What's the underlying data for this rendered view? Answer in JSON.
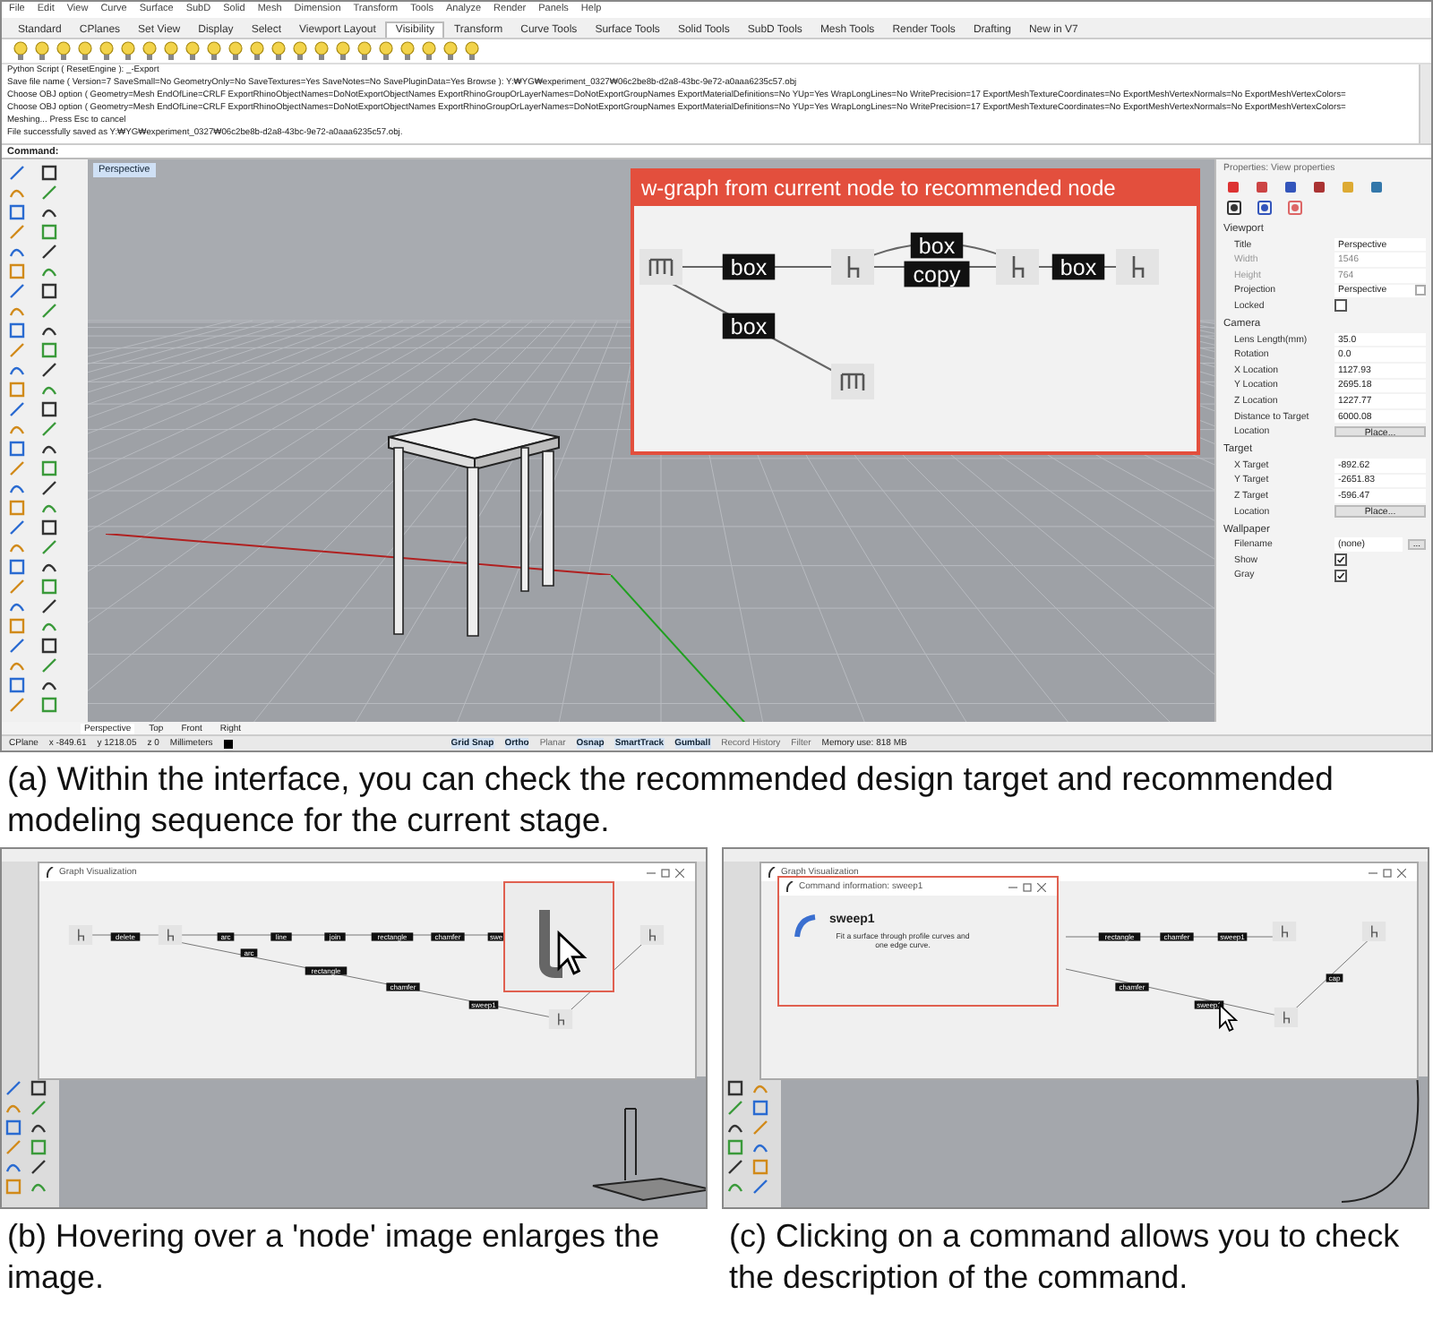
{
  "panel_a": {
    "menu": [
      "File",
      "Edit",
      "View",
      "Curve",
      "Surface",
      "SubD",
      "Solid",
      "Mesh",
      "Dimension",
      "Transform",
      "Tools",
      "Analyze",
      "Render",
      "Panels",
      "Help"
    ],
    "tabs": [
      {
        "label": "Standard",
        "selected": false
      },
      {
        "label": "CPlanes",
        "selected": false
      },
      {
        "label": "Set View",
        "selected": false
      },
      {
        "label": "Display",
        "selected": false
      },
      {
        "label": "Select",
        "selected": false
      },
      {
        "label": "Viewport Layout",
        "selected": false
      },
      {
        "label": "Visibility",
        "selected": true
      },
      {
        "label": "Transform",
        "selected": false
      },
      {
        "label": "Curve Tools",
        "selected": false
      },
      {
        "label": "Surface Tools",
        "selected": false
      },
      {
        "label": "Solid Tools",
        "selected": false
      },
      {
        "label": "SubD Tools",
        "selected": false
      },
      {
        "label": "Mesh Tools",
        "selected": false
      },
      {
        "label": "Render Tools",
        "selected": false
      },
      {
        "label": "Drafting",
        "selected": false
      },
      {
        "label": "New in V7",
        "selected": false
      }
    ],
    "history": [
      "Python Script ( ResetEngine ): _-Export",
      "Save file name ( Version=7  SaveSmall=No  GeometryOnly=No  SaveTextures=Yes  SaveNotes=No  SavePluginData=Yes  Browse ): Y:₩YG₩experiment_0327₩06c2be8b-d2a8-43bc-9e72-a0aaa6235c57.obj",
      "Choose OBJ option ( Geometry=Mesh  EndOfLine=CRLF  ExportRhinoObjectNames=DoNotExportObjectNames  ExportRhinoGroupOrLayerNames=DoNotExportGroupNames  ExportMaterialDefinitions=No  YUp=Yes  WrapLongLines=No  WritePrecision=17  ExportMeshTextureCoordinates=No  ExportMeshVertexNormals=No  ExportMeshVertexColors=",
      "Choose OBJ option ( Geometry=Mesh  EndOfLine=CRLF  ExportRhinoObjectNames=DoNotExportObjectNames  ExportRhinoGroupOrLayerNames=DoNotExportGroupNames  ExportMaterialDefinitions=No  YUp=Yes  WrapLongLines=No  WritePrecision=17  ExportMeshTextureCoordinates=No  ExportMeshVertexNormals=No  ExportMeshVertexColors=",
      "Meshing... Press Esc to cancel",
      "File successfully saved as Y:₩YG₩experiment_0327₩06c2be8b-d2a8-43bc-9e72-a0aaa6235c57.obj."
    ],
    "command_label": "Command:",
    "viewport_title": "Perspective",
    "graph_card": {
      "title": "w-graph from current node to recommended node",
      "nodes": [
        {
          "kind": "table"
        },
        {
          "kind": "chair"
        },
        {
          "kind": "chair"
        },
        {
          "kind": "chair"
        },
        {
          "kind": "table"
        }
      ],
      "edges": [
        {
          "label": "box"
        },
        {
          "label": "box"
        },
        {
          "label": "copy"
        },
        {
          "label": "box"
        },
        {
          "label": "box"
        }
      ]
    },
    "properties": {
      "header": "Properties: View properties",
      "sections": [
        {
          "title": "Viewport",
          "rows": [
            {
              "label": "Title",
              "value": "Perspective",
              "kind": "text",
              "disabled": false
            },
            {
              "label": "Width",
              "value": "1546",
              "kind": "text",
              "disabled": true
            },
            {
              "label": "Height",
              "value": "764",
              "kind": "text",
              "disabled": true
            },
            {
              "label": "Projection",
              "value": "Perspective",
              "kind": "dropdown",
              "disabled": false
            },
            {
              "label": "Locked",
              "kind": "checkbox",
              "checked": false,
              "disabled": false
            }
          ]
        },
        {
          "title": "Camera",
          "rows": [
            {
              "label": "Lens Length(mm)",
              "value": "35.0",
              "kind": "text",
              "disabled": false
            },
            {
              "label": "Rotation",
              "value": "0.0",
              "kind": "text",
              "disabled": false
            },
            {
              "label": "X Location",
              "value": "1127.93",
              "kind": "text",
              "disabled": false
            },
            {
              "label": "Y Location",
              "value": "2695.18",
              "kind": "text",
              "disabled": false
            },
            {
              "label": "Z Location",
              "value": "1227.77",
              "kind": "text",
              "disabled": false
            },
            {
              "label": "Distance to Target",
              "value": "6000.08",
              "kind": "text",
              "disabled": false
            },
            {
              "label": "Location",
              "value": "Place...",
              "kind": "button",
              "disabled": false
            }
          ]
        },
        {
          "title": "Target",
          "rows": [
            {
              "label": "X Target",
              "value": "-892.62",
              "kind": "text",
              "disabled": false
            },
            {
              "label": "Y Target",
              "value": "-2651.83",
              "kind": "text",
              "disabled": false
            },
            {
              "label": "Z Target",
              "value": "-596.47",
              "kind": "text",
              "disabled": false
            },
            {
              "label": "Location",
              "value": "Place...",
              "kind": "button",
              "disabled": false
            }
          ]
        },
        {
          "title": "Wallpaper",
          "rows": [
            {
              "label": "Filename",
              "value": "(none)",
              "kind": "file",
              "button": "...",
              "disabled": false
            },
            {
              "label": "Show",
              "kind": "checkbox",
              "checked": true,
              "disabled": false
            },
            {
              "label": "Gray",
              "kind": "checkbox",
              "checked": true,
              "disabled": false
            }
          ]
        }
      ]
    },
    "view_tabs": [
      {
        "label": "Perspective",
        "selected": true
      },
      {
        "label": "Top",
        "selected": false
      },
      {
        "label": "Front",
        "selected": false
      },
      {
        "label": "Right",
        "selected": false
      }
    ],
    "status_bar": {
      "cplane": "CPlane",
      "coords": [
        "x -849.61",
        "y 1218.05",
        "z 0"
      ],
      "units": "Millimeters",
      "toggles": [
        {
          "label": "Grid Snap",
          "on": true
        },
        {
          "label": "Ortho",
          "on": true
        },
        {
          "label": "Planar",
          "on": false
        },
        {
          "label": "Osnap",
          "on": true
        },
        {
          "label": "SmartTrack",
          "on": true
        },
        {
          "label": "Gumball",
          "on": true
        },
        {
          "label": "Record History",
          "on": false
        },
        {
          "label": "Filter",
          "on": false
        }
      ],
      "memory": "Memory use: 818 MB"
    },
    "caption": "(a) Within the interface, you can check the recommended design target and recommended modeling sequence for the current stage."
  },
  "panel_b": {
    "window_title": "Graph Visualization",
    "top_edges": [
      "delete",
      "arc",
      "line",
      "join",
      "rectangle",
      "chamfer",
      "swe"
    ],
    "bottom_edges": [
      "arc",
      "rectangle",
      "chamfer",
      "sweep1"
    ],
    "caption": "(b) Hovering over a 'node' image enlarges the image."
  },
  "panel_c": {
    "window_title": "Graph Visualization",
    "popup": {
      "title": "Command information: sweep1",
      "command": "sweep1",
      "description": "Fit a surface through profile curves and one edge curve."
    },
    "top_edges": [
      "rectangle",
      "chamfer",
      "sweep1"
    ],
    "bottom_edges": [
      "chamfer",
      "sweep1",
      "cap"
    ],
    "caption": "(c) Clicking on a command allows you to check the description of the command."
  }
}
